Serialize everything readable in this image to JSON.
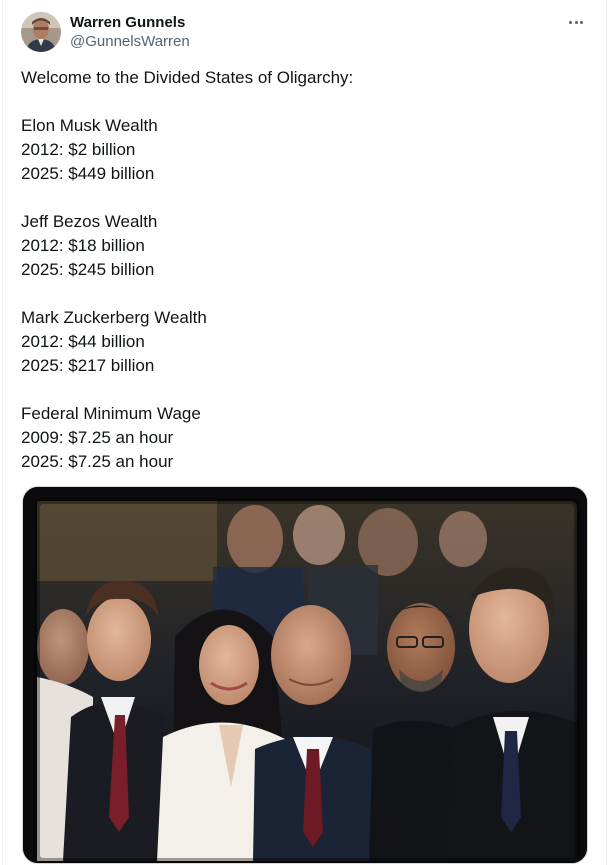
{
  "author": {
    "display_name": "Warren Gunnels",
    "handle": "@GunnelsWarren"
  },
  "more_icon": "more-horizontal-icon",
  "tweet": {
    "intro": "Welcome to the Divided States of Oligarchy:",
    "sections": [
      {
        "lines": [
          "Elon Musk Wealth",
          "2012: $2 billion",
          "2025: $449 billion"
        ]
      },
      {
        "lines": [
          "Jeff Bezos Wealth",
          "2012: $18 billion",
          "2025: $245 billion"
        ]
      },
      {
        "lines": [
          "Mark Zuckerberg Wealth",
          "2012: $44 billion",
          "2025: $217 billion"
        ]
      },
      {
        "lines": [
          "Federal Minimum Wage",
          "2009: $7.25 an hour",
          "2025: $7.25 an hour"
        ]
      }
    ]
  },
  "colors": {
    "text": "#0f1419",
    "secondary": "#536471",
    "border": "#cfd9de"
  }
}
